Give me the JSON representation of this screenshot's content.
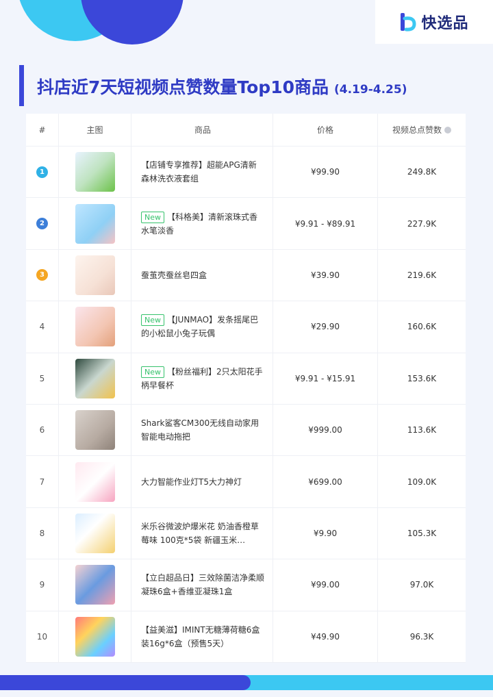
{
  "brand": {
    "name": "快选品"
  },
  "title": {
    "main": "抖店近7天短视频点赞数量Top10商品",
    "range": "(4.19-4.25)"
  },
  "columns": {
    "rank": "#",
    "image": "主图",
    "product": "商品",
    "price": "价格",
    "likes": "视频总点赞数"
  },
  "rank_colors": {
    "1": "#2fb1e6",
    "2": "#3d7fd9",
    "3": "#f5a623"
  },
  "rows": [
    {
      "rank": "1",
      "new": "",
      "name": "【店铺专享推荐】超能APG清新森林洗衣液套组",
      "price": "¥99.90",
      "likes": "249.8K",
      "thumb": "detergent bottles"
    },
    {
      "rank": "2",
      "new": "New",
      "name": "【科格美】清新滚珠式香水笔淡香",
      "price": "¥9.91 - ¥89.91",
      "likes": "227.9K",
      "thumb": "perfume pens"
    },
    {
      "rank": "3",
      "new": "",
      "name": "蚕茧壳蚕丝皂四盒",
      "price": "¥39.90",
      "likes": "219.6K",
      "thumb": "silk soap boxes"
    },
    {
      "rank": "4",
      "new": "New",
      "name": "【JUNMAO】发条摇尾巴的小松鼠小兔子玩偶",
      "price": "¥29.90",
      "likes": "160.6K",
      "thumb": "plush toys"
    },
    {
      "rank": "5",
      "new": "New",
      "name": "【粉丝福利】2只太阳花手柄早餐杯",
      "price": "¥9.91 - ¥15.91",
      "likes": "153.6K",
      "thumb": "breakfast cups"
    },
    {
      "rank": "6",
      "new": "",
      "name": "Shark鲨客CM300无线自动家用智能电动拖把",
      "price": "¥999.00",
      "likes": "113.6K",
      "thumb": "electric mop"
    },
    {
      "rank": "7",
      "new": "",
      "name": "大力智能作业灯T5大力神灯",
      "price": "¥699.00",
      "likes": "109.0K",
      "thumb": "desk lamp"
    },
    {
      "rank": "8",
      "new": "",
      "name": "米乐谷微波炉爆米花 奶油香橙草莓味 100克*5袋 新疆玉米…",
      "price": "¥9.90",
      "likes": "105.3K",
      "thumb": "popcorn"
    },
    {
      "rank": "9",
      "new": "",
      "name": "【立白超品日】三效除菌洁净柔顺凝珠6盒+香维亚凝珠1盒",
      "price": "¥99.00",
      "likes": "97.0K",
      "thumb": "laundry pods"
    },
    {
      "rank": "10",
      "new": "",
      "name": "【益美滋】IMINT无糖薄荷糖6盒装16g*6盒（预售5天）",
      "price": "¥49.90",
      "likes": "96.3K",
      "thumb": "mint candy"
    }
  ]
}
